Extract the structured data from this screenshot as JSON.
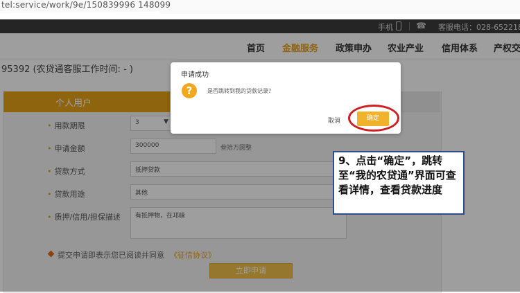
{
  "browser": {
    "url": "tel:service/work/9e/150839996 148099"
  },
  "topbar": {
    "phone_label": "手机",
    "hotline": "客服电话：028-652218"
  },
  "nav": {
    "items": [
      {
        "label": "首页"
      },
      {
        "label": "金融服务",
        "active": true
      },
      {
        "label": "政策申办"
      },
      {
        "label": "农业产业"
      },
      {
        "label": "信用体系"
      },
      {
        "label": "产权交"
      }
    ]
  },
  "page": {
    "info_text": "95392 (农贷通客服工作时间: - )",
    "tab_label": "个人用户"
  },
  "form": {
    "term_label": "用款期限",
    "term_value": "3",
    "amount_label": "申请金额",
    "amount_value": "300000",
    "amount_hint": "叁拾万圆整",
    "method_label": "贷款方式",
    "method_value": "抵押贷款",
    "purpose_label": "贷款用途",
    "purpose_value": "其他",
    "collateral_label": "质押/信用/担保描述",
    "collateral_value": "有抵押物，在邛崃"
  },
  "agreement": {
    "text": "提交申请即表示您已阅读并同意",
    "link": "《征信协议》"
  },
  "submit_label": "立即申请",
  "dialog": {
    "title": "申请成功",
    "icon_glyph": "?",
    "message": "是否跳转到我的贷款记录？",
    "cancel_label": "取消",
    "confirm_label": "确定"
  },
  "callout": {
    "text": "9、点击“确定”，跳转至“我的农贷通”界面可查看详情，查看贷款进度"
  },
  "colors": {
    "accent": "#e6a317",
    "highlight_ring": "#cc1f1f",
    "callout_border": "#2e4d8c"
  }
}
